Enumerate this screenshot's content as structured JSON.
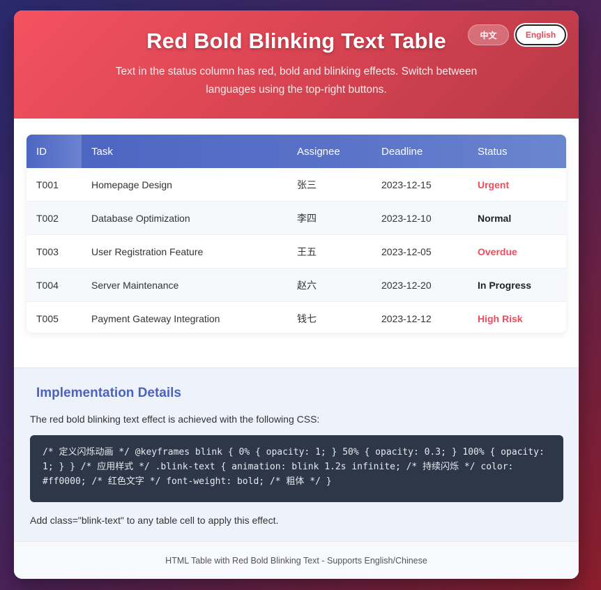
{
  "header": {
    "title": "Red Bold Blinking Text Table",
    "subtitle": "Text in the status column has red, bold and blinking effects. Switch between languages using the top-right buttons.",
    "lang_zh": "中文",
    "lang_en": "English"
  },
  "table": {
    "columns": [
      "ID",
      "Task",
      "Assignee",
      "Deadline",
      "Status"
    ],
    "rows": [
      {
        "id": "T001",
        "task": "Homepage Design",
        "assignee": "张三",
        "deadline": "2023-12-15",
        "status": "Urgent",
        "blink": true
      },
      {
        "id": "T002",
        "task": "Database Optimization",
        "assignee": "李四",
        "deadline": "2023-12-10",
        "status": "Normal",
        "blink": false
      },
      {
        "id": "T003",
        "task": "User Registration Feature",
        "assignee": "王五",
        "deadline": "2023-12-05",
        "status": "Overdue",
        "blink": true
      },
      {
        "id": "T004",
        "task": "Server Maintenance",
        "assignee": "赵六",
        "deadline": "2023-12-20",
        "status": "In Progress",
        "blink": false
      },
      {
        "id": "T005",
        "task": "Payment Gateway Integration",
        "assignee": "钱七",
        "deadline": "2023-12-12",
        "status": "High Risk",
        "blink": true
      }
    ]
  },
  "details": {
    "heading": "Implementation Details",
    "intro": "The red bold blinking text effect is achieved with the following CSS:",
    "code": "/* 定义闪烁动画 */ @keyframes blink { 0% { opacity: 1; } 50% { opacity: 0.3; } 100% { opacity: 1; } } /* 应用样式 */ .blink-text { animation: blink 1.2s infinite; /* 持续闪烁 */ color: #ff0000; /* 红色文字 */ font-weight: bold; /* 粗体 */ }",
    "note": "Add class=\"blink-text\" to any table cell to apply this effect."
  },
  "footer": {
    "text": "HTML Table with Red Bold Blinking Text - Supports English/Chinese"
  },
  "colors": {
    "header_start": "#f4525f",
    "header_end": "#b73846",
    "table_header": "#4a63c0",
    "status_red": "#f2495b",
    "code_bg": "#2d3748"
  }
}
